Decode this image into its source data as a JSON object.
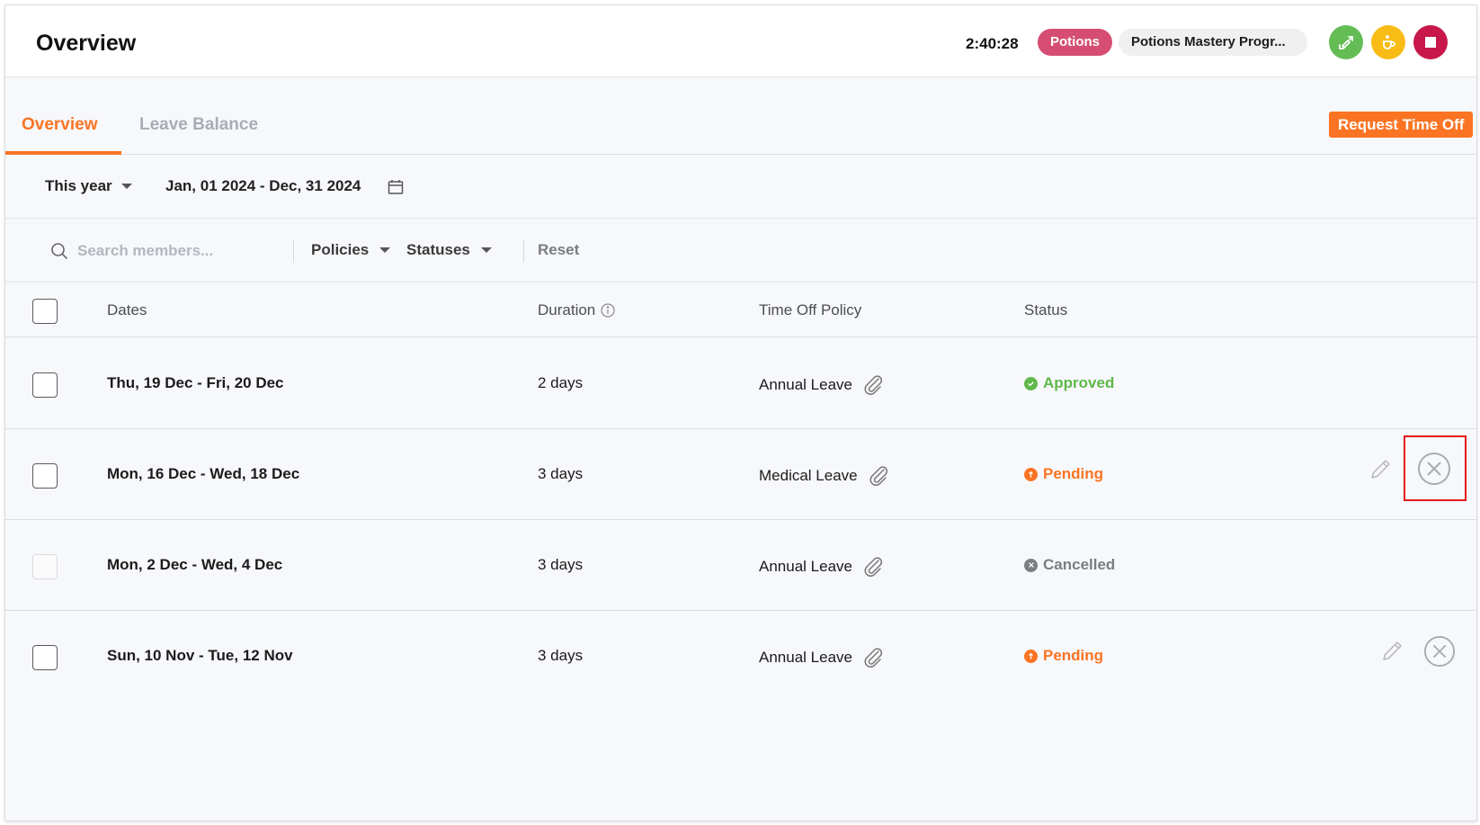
{
  "header": {
    "title": "Overview",
    "timer": "2:40:28",
    "project_badge": "Potions",
    "task_badge": "Potions Mastery Progr...",
    "actions": [
      {
        "name": "switch-task",
        "icon": "tag-swap-icon",
        "color": "#64bc55"
      },
      {
        "name": "break",
        "icon": "coffee-cup-icon",
        "color": "#f9bc16"
      },
      {
        "name": "stop",
        "icon": "stop-square-icon",
        "color": "#c8174a"
      }
    ]
  },
  "tabs": [
    {
      "label": "Overview",
      "active": true
    },
    {
      "label": "Leave Balance",
      "active": false
    }
  ],
  "request_button": "Request Time Off",
  "date_filter": {
    "period": "This year",
    "range": "Jan, 01 2024 - Dec, 31 2024"
  },
  "filters": {
    "search_placeholder": "Search members...",
    "search_value": "",
    "policies": "Policies",
    "statuses": "Statuses",
    "reset": "Reset"
  },
  "table": {
    "columns": {
      "dates": "Dates",
      "duration": "Duration",
      "policy": "Time Off Policy",
      "status": "Status"
    },
    "rows": [
      {
        "dates": "Thu, 19 Dec - Fri, 20 Dec",
        "duration": "2 days",
        "policy": "Annual Leave",
        "status": "Approved",
        "status_color": "#5fb84a",
        "selectable": true,
        "actions": false
      },
      {
        "dates": "Mon, 16 Dec - Wed, 18 Dec",
        "duration": "3 days",
        "policy": "Medical Leave",
        "status": "Pending",
        "status_color": "#fa7423",
        "selectable": true,
        "actions": true,
        "highlighted": "cancel"
      },
      {
        "dates": "Mon, 2 Dec - Wed, 4 Dec",
        "duration": "3 days",
        "policy": "Annual Leave",
        "status": "Cancelled",
        "status_color": "#7b7d82",
        "selectable": false,
        "actions": false
      },
      {
        "dates": "Sun, 10 Nov - Tue, 12 Nov",
        "duration": "3 days",
        "policy": "Annual Leave",
        "status": "Pending",
        "status_color": "#fa7423",
        "selectable": true,
        "actions": true
      }
    ]
  }
}
